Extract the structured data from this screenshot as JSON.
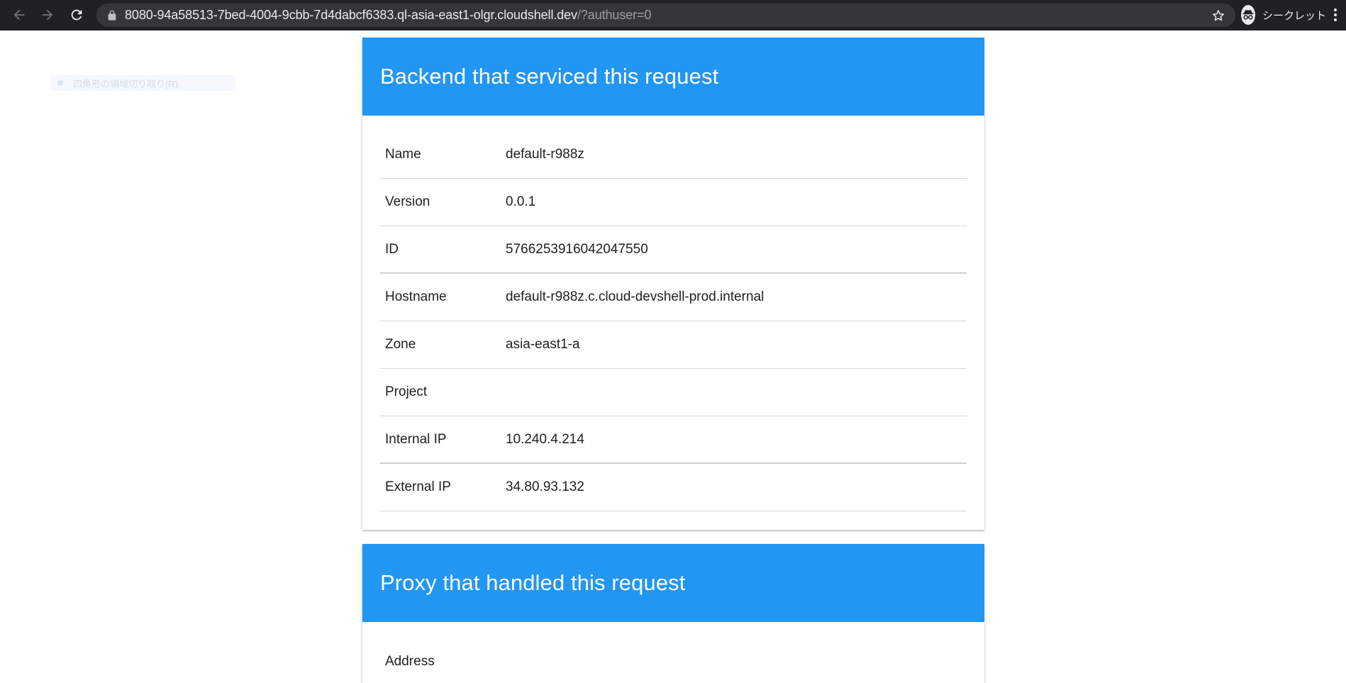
{
  "browser": {
    "url_main": "8080-94a58513-7bed-4004-9cbb-7d4dabcf6383.ql-asia-east1-olgr.cloudshell.dev",
    "url_rest": "/?authuser=0",
    "incognito_label": "シークレット",
    "icons": {
      "back": "back-arrow-icon",
      "forward": "forward-arrow-icon",
      "reload": "reload-icon",
      "lock": "lock-icon",
      "bookmark": "star-icon",
      "incognito": "incognito-icon",
      "menu": "more-vert-icon"
    }
  },
  "overlay": {
    "snip_hint": "四角形の領域切り取り(R)"
  },
  "backend": {
    "title": "Backend that serviced this request",
    "rows": [
      {
        "key": "Name",
        "value": "default-r988z"
      },
      {
        "key": "Version",
        "value": "0.0.1"
      },
      {
        "key": "ID",
        "value": "5766253916042047550"
      },
      {
        "key": "Hostname",
        "value": "default-r988z.c.cloud-devshell-prod.internal"
      },
      {
        "key": "Zone",
        "value": "asia-east1-a"
      },
      {
        "key": "Project",
        "value": ""
      },
      {
        "key": "Internal IP",
        "value": "10.240.4.214"
      },
      {
        "key": "External IP",
        "value": "34.80.93.132"
      }
    ]
  },
  "proxy": {
    "title": "Proxy that handled this request",
    "rows": [
      {
        "key": "Address",
        "value": ""
      }
    ]
  },
  "colors": {
    "chrome_bg": "#202124",
    "omnibox_bg": "#35363a",
    "header_blue": "#2196f3"
  }
}
